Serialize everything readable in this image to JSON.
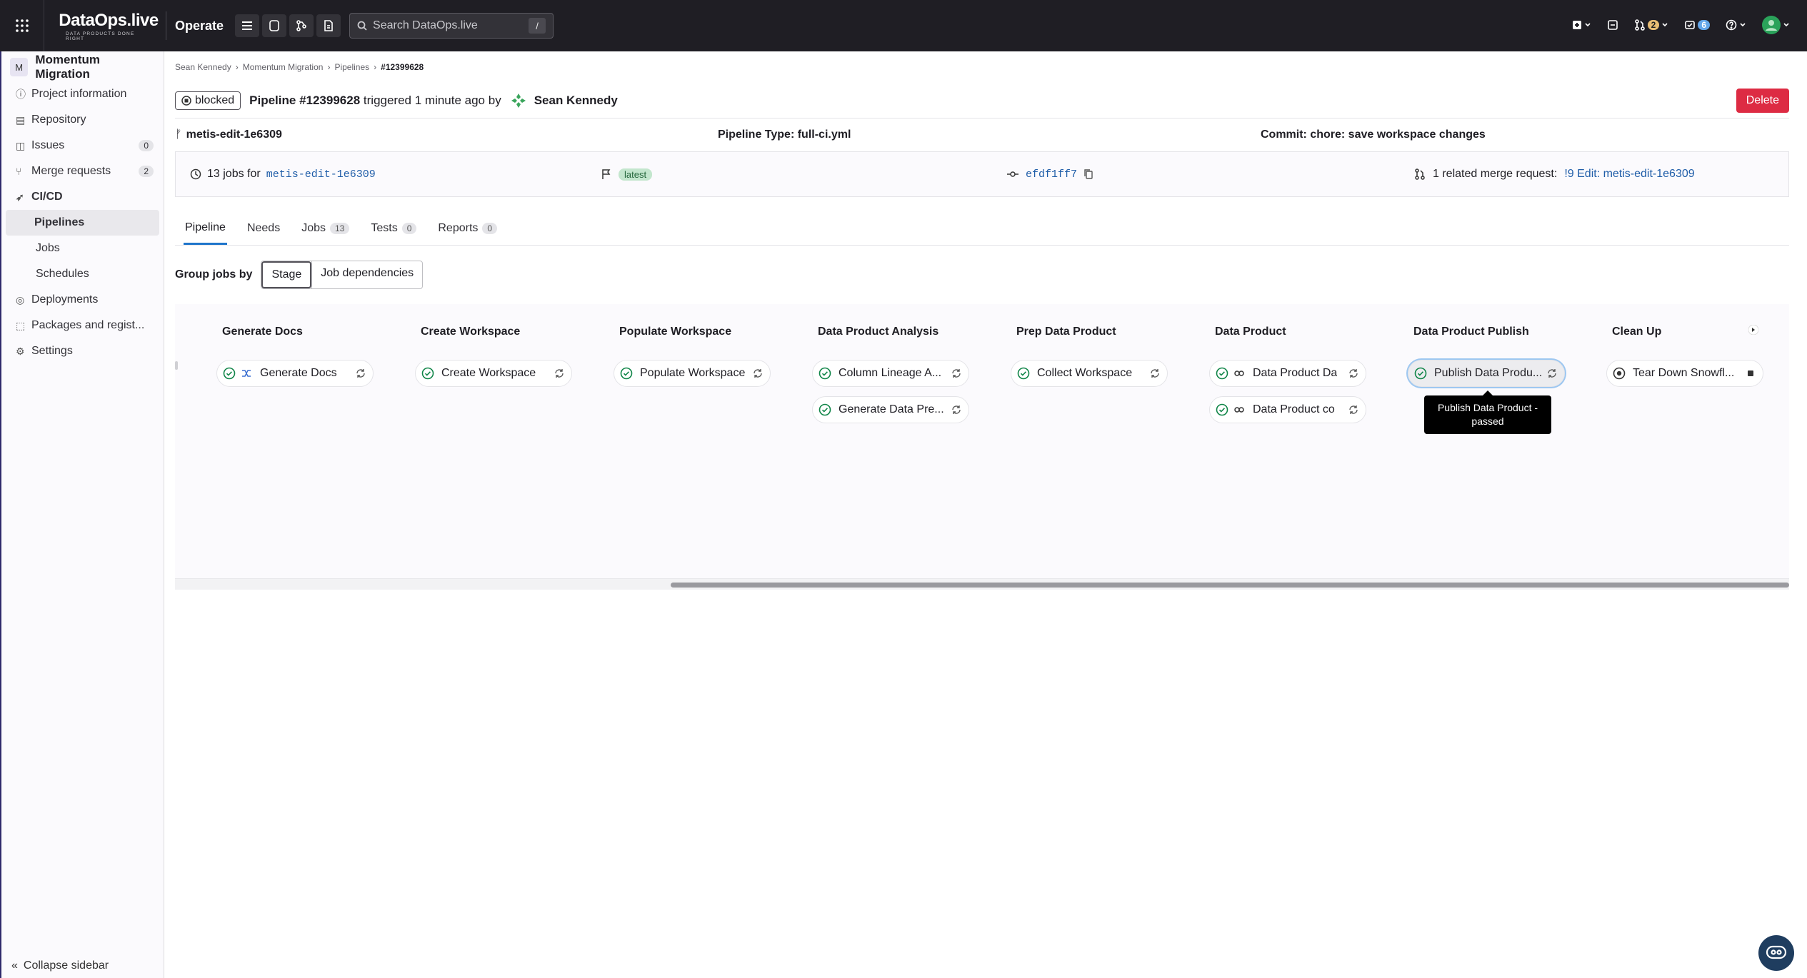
{
  "topbar": {
    "logo": "DataOps.live",
    "logo_tagline": "DATA PRODUCTS DONE RIGHT",
    "context": "Operate",
    "search_placeholder": "Search DataOps.live",
    "search_shortcut": "/",
    "mr_count": "2",
    "todo_count": "6"
  },
  "sidebar": {
    "project_initial": "M",
    "project_name": "Momentum Migration",
    "items": [
      {
        "label": "Project information",
        "icon": "info-icon"
      },
      {
        "label": "Repository",
        "icon": "doc-icon"
      },
      {
        "label": "Issues",
        "icon": "issues-icon",
        "count": "0"
      },
      {
        "label": "Merge requests",
        "icon": "merge-icon",
        "count": "2"
      },
      {
        "label": "CI/CD",
        "icon": "rocket-icon"
      }
    ],
    "cicd_sub": [
      "Pipelines",
      "Jobs",
      "Schedules"
    ],
    "items_after": [
      {
        "label": "Deployments",
        "icon": "deploy-icon"
      },
      {
        "label": "Packages and regist...",
        "icon": "package-icon"
      },
      {
        "label": "Settings",
        "icon": "gear-icon"
      }
    ],
    "collapse_label": "Collapse sidebar"
  },
  "breadcrumb": [
    "Sean Kennedy",
    "Momentum Migration",
    "Pipelines",
    "#12399628"
  ],
  "pipeline": {
    "status": "blocked",
    "title": "Pipeline #12399628",
    "triggered": "triggered 1 minute ago by",
    "user": "Sean Kennedy",
    "delete_label": "Delete",
    "branch": "metis-edit-1e6309",
    "type": "Pipeline Type: full-ci.yml",
    "commit": "Commit: chore: save workspace changes"
  },
  "summary": {
    "jobs_text": "13 jobs for",
    "jobs_branch": "metis-edit-1e6309",
    "latest": "latest",
    "sha": "efdf1ff7",
    "mr_text": "1 related merge request:",
    "mr_link": "!9 Edit: metis-edit-1e6309"
  },
  "tabs": [
    {
      "label": "Pipeline"
    },
    {
      "label": "Needs"
    },
    {
      "label": "Jobs",
      "count": "13"
    },
    {
      "label": "Tests",
      "count": "0"
    },
    {
      "label": "Reports",
      "count": "0"
    }
  ],
  "group": {
    "label": "Group jobs by",
    "options": [
      "Stage",
      "Job dependencies"
    ]
  },
  "stages": [
    {
      "name": "Generate Docs",
      "jobs": [
        "Generate Docs"
      ]
    },
    {
      "name": "Create Workspace",
      "jobs": [
        "Create Workspace"
      ]
    },
    {
      "name": "Populate Workspace",
      "jobs": [
        "Populate Workspace"
      ]
    },
    {
      "name": "Data Product Analysis",
      "jobs": [
        "Column Lineage A...",
        "Generate Data Pre..."
      ]
    },
    {
      "name": "Prep Data Product",
      "jobs": [
        "Collect Workspace"
      ]
    },
    {
      "name": "Data Product",
      "jobs": [
        "Data Product Da",
        "Data Product co"
      ]
    },
    {
      "name": "Data Product Publish",
      "jobs": [
        "Publish Data Produ..."
      ]
    },
    {
      "name": "Clean Up",
      "jobs": [
        "Tear Down Snowfl..."
      ]
    }
  ],
  "tooltip": "Publish Data Product - passed",
  "colors": {
    "topbar": "#1f1e24",
    "success": "#108548",
    "danger": "#dd2b43",
    "link": "#1f5da8"
  }
}
